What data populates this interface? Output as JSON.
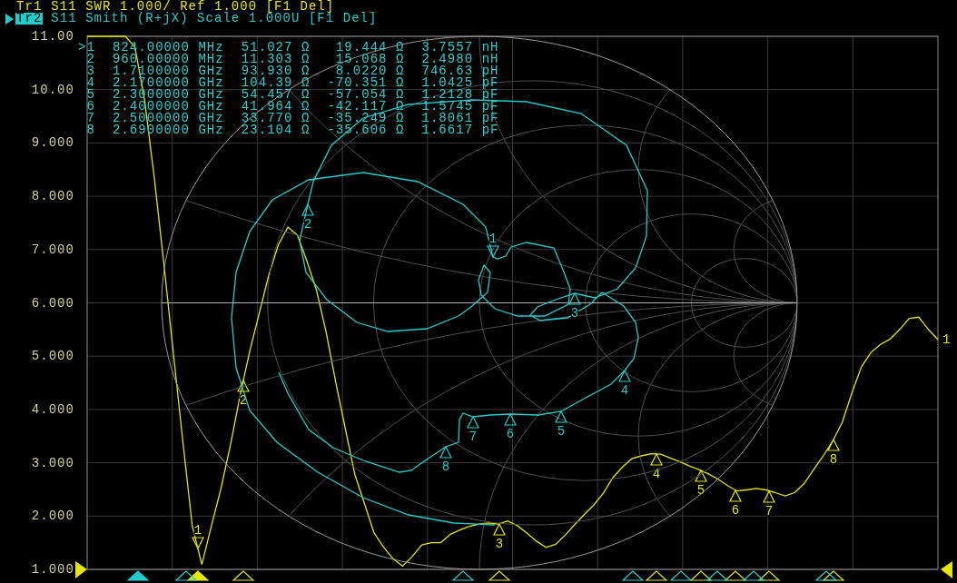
{
  "traces": [
    {
      "name": "Tr1",
      "settings": "S11 SWR 1.000/ Ref 1.000 [F1 Del]",
      "selected": false,
      "color": "#e6e600"
    },
    {
      "name": "Tr2",
      "settings": "S11 Smith (R+jX) Scale 1.000U [F1 Del]",
      "selected": true,
      "color": "#22cccc"
    }
  ],
  "marker_table": {
    "rows": [
      {
        "marker": ">1",
        "frequency": "824.00000 MHz",
        "resistance": "51.027 Ω",
        "reactance": "19.444 Ω",
        "equivalent": "3.7557 nH"
      },
      {
        "marker": "2",
        "frequency": "960.00000 MHz",
        "resistance": "11.303 Ω",
        "reactance": "15.068 Ω",
        "equivalent": "2.4980 nH"
      },
      {
        "marker": "3",
        "frequency": "1.7100000 GHz",
        "resistance": "93.930 Ω",
        "reactance": "8.0220 Ω",
        "equivalent": "746.63 pH"
      },
      {
        "marker": "4",
        "frequency": "2.1700000 GHz",
        "resistance": "104.39 Ω",
        "reactance": "-70.351 Ω",
        "equivalent": "1.0425 pF"
      },
      {
        "marker": "5",
        "frequency": "2.3000000 GHz",
        "resistance": "54.457 Ω",
        "reactance": "-57.054 Ω",
        "equivalent": "1.2128 pF"
      },
      {
        "marker": "6",
        "frequency": "2.4000000 GHz",
        "resistance": "41.964 Ω",
        "reactance": "-42.117 Ω",
        "equivalent": "1.5745 pF"
      },
      {
        "marker": "7",
        "frequency": "2.5000000 GHz",
        "resistance": "33.770 Ω",
        "reactance": "-35.249 Ω",
        "equivalent": "1.8061 pF"
      },
      {
        "marker": "8",
        "frequency": "2.6900000 GHz",
        "resistance": "23.104 Ω",
        "reactance": "-35.606 Ω",
        "equivalent": "1.6617 pF"
      }
    ]
  },
  "swr_plot": {
    "chart_data": {
      "type": "line",
      "grid": true,
      "ylim": [
        1,
        11
      ],
      "yticks": [
        {
          "value": 11,
          "label": "11.00"
        },
        {
          "value": 10,
          "label": "10.00"
        },
        {
          "value": 9,
          "label": "9.000"
        },
        {
          "value": 8,
          "label": "8.000"
        },
        {
          "value": 7,
          "label": "7.000"
        },
        {
          "value": 6,
          "label": "6.000"
        },
        {
          "value": 5,
          "label": "5.000"
        },
        {
          "value": 4,
          "label": "4.000"
        },
        {
          "value": 3,
          "label": "3.000"
        },
        {
          "value": 2,
          "label": "2.000"
        },
        {
          "value": 1,
          "label": "1.000"
        }
      ],
      "categories": [
        null,
        null,
        null,
        null,
        null,
        null,
        null,
        null,
        null,
        null,
        null,
        null,
        null,
        null,
        null,
        null,
        null,
        null,
        null,
        null,
        null,
        null,
        null,
        null,
        null,
        null,
        null,
        null,
        null,
        null,
        null,
        null,
        null,
        null,
        null,
        null,
        null,
        null,
        null,
        null,
        null,
        null,
        null,
        null,
        null,
        null,
        null,
        null,
        null,
        null,
        null,
        null,
        null,
        null,
        null,
        null,
        null,
        null,
        null,
        null,
        null,
        null,
        null,
        null,
        null,
        null,
        null,
        null,
        null,
        null,
        null,
        null,
        null,
        null,
        null,
        null,
        null,
        null,
        null,
        null,
        null,
        null,
        null,
        null,
        null,
        null,
        null,
        null,
        null,
        null
      ],
      "series": [
        {
          "name": "1",
          "color": "#e6e600",
          "values": [
            11,
            11,
            11,
            11,
            11,
            10.8,
            9.81,
            8.38,
            6.78,
            5.08,
            3.41,
            1.81,
            1.09,
            1.82,
            2.52,
            3.34,
            4.26,
            5.09,
            5.8,
            6.52,
            7.09,
            7.42,
            7.27,
            6.78,
            6.23,
            5.45,
            4.52,
            3.64,
            2.78,
            2.24,
            1.69,
            1.42,
            1.2,
            1.06,
            1.24,
            1.46,
            1.5,
            1.5,
            1.66,
            1.74,
            1.81,
            1.85,
            1.87,
            1.85,
            1.91,
            1.82,
            1.68,
            1.53,
            1.41,
            1.47,
            1.64,
            1.84,
            2.03,
            2.21,
            2.43,
            2.72,
            2.92,
            3.08,
            3.13,
            3.17,
            3.16,
            3.09,
            3.02,
            2.94,
            2.87,
            2.79,
            2.69,
            2.57,
            2.47,
            2.49,
            2.52,
            2.49,
            2.44,
            2.38,
            2.44,
            2.61,
            2.87,
            3.13,
            3.41,
            3.76,
            4.31,
            4.8,
            5.07,
            5.22,
            5.32,
            5.5,
            5.71,
            5.73,
            5.5,
            5.31
          ]
        }
      ]
    },
    "markers": [
      {
        "label": "1",
        "active": true
      },
      {
        "label": "2",
        "active": false
      },
      {
        "label": "3",
        "active": false
      },
      {
        "label": "4",
        "active": false
      },
      {
        "label": "5",
        "active": false
      },
      {
        "label": "6",
        "active": false
      },
      {
        "label": "7",
        "active": false
      },
      {
        "label": "8",
        "active": false
      }
    ]
  },
  "smith_plot": {
    "markers": [
      {
        "label": "1",
        "active": true
      },
      {
        "label": "2",
        "active": false
      },
      {
        "label": "3",
        "active": false
      },
      {
        "label": "4",
        "active": false
      },
      {
        "label": "7",
        "active": false
      },
      {
        "label": "6",
        "active": false
      },
      {
        "label": "5",
        "active": false
      },
      {
        "label": "8",
        "active": false
      }
    ]
  }
}
